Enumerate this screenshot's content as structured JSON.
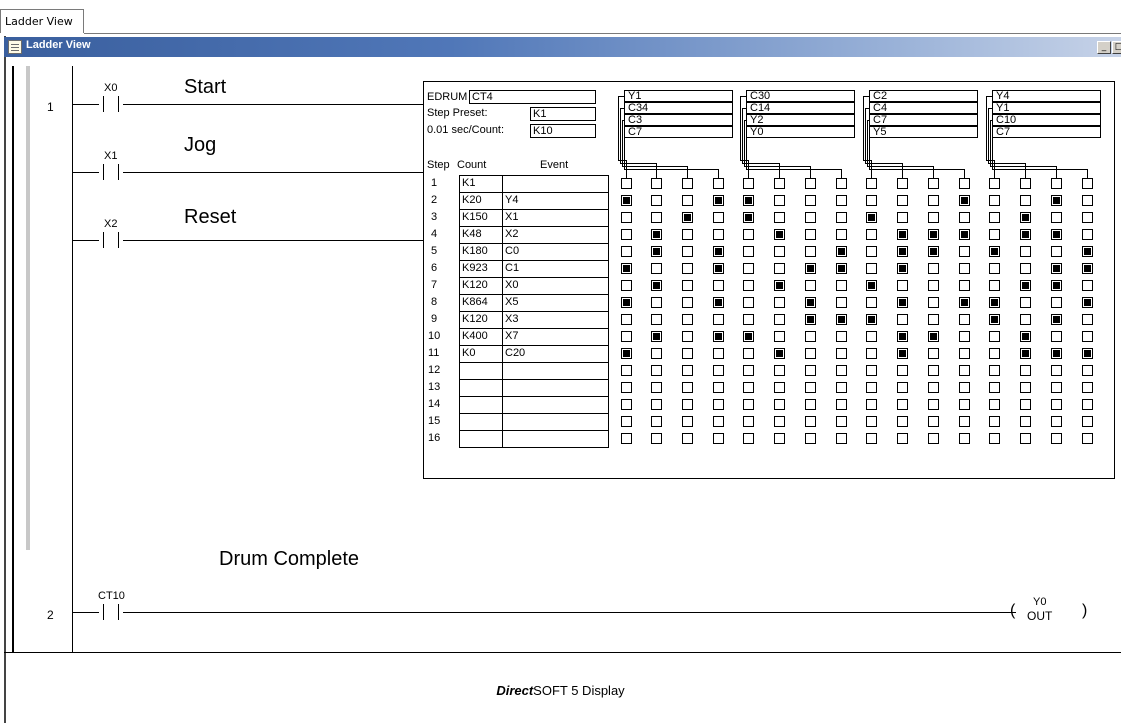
{
  "tab": {
    "label": "Ladder View"
  },
  "window": {
    "title": "Ladder View"
  },
  "rungs": [
    {
      "number": "1",
      "contacts": [
        {
          "address": "X0",
          "label": "Start"
        },
        {
          "address": "X1",
          "label": "Jog"
        },
        {
          "address": "X2",
          "label": "Reset"
        }
      ]
    },
    {
      "number": "2",
      "contact": {
        "address": "CT10",
        "label": "Drum Complete"
      },
      "coil": {
        "address": "Y0",
        "type": "OUT"
      }
    }
  ],
  "drum": {
    "instruction": "EDRUM",
    "counter": "CT4",
    "step_preset_label": "Step Preset:",
    "step_preset": "K1",
    "count_label": "0.01 sec/Count:",
    "count_value": "K10",
    "header_step": "Step",
    "header_count": "Count",
    "header_event": "Event",
    "output_groups": [
      [
        "Y1",
        "C34",
        "C3",
        "C7"
      ],
      [
        "C30",
        "C14",
        "Y2",
        "Y0"
      ],
      [
        "C2",
        "C4",
        "C7",
        "Y5"
      ],
      [
        "Y4",
        "Y1",
        "C10",
        "C7"
      ]
    ],
    "steps": [
      {
        "step": "1",
        "count": "K1",
        "event": "",
        "bits": "0000000000000000"
      },
      {
        "step": "2",
        "count": "K20",
        "event": "Y4",
        "bits": "1001100000010010"
      },
      {
        "step": "3",
        "count": "K150",
        "event": "X1",
        "bits": "0010100010000100"
      },
      {
        "step": "4",
        "count": "K48",
        "event": "X2",
        "bits": "0100010001110110"
      },
      {
        "step": "5",
        "count": "K180",
        "event": "C0",
        "bits": "0101000101101001"
      },
      {
        "step": "6",
        "count": "K923",
        "event": "C1",
        "bits": "1001001101000011"
      },
      {
        "step": "7",
        "count": "K120",
        "event": "X0",
        "bits": "0100010010000110"
      },
      {
        "step": "8",
        "count": "K864",
        "event": "X5",
        "bits": "1001001001011001"
      },
      {
        "step": "9",
        "count": "K120",
        "event": "X3",
        "bits": "0000001110001010"
      },
      {
        "step": "10",
        "count": "K400",
        "event": "X7",
        "bits": "0101100001100100"
      },
      {
        "step": "11",
        "count": "K0",
        "event": "C20",
        "bits": "1000010001000111"
      },
      {
        "step": "12",
        "count": "",
        "event": "",
        "bits": "0000000000000000"
      },
      {
        "step": "13",
        "count": "",
        "event": "",
        "bits": "0000000000000000"
      },
      {
        "step": "14",
        "count": "",
        "event": "",
        "bits": "0000000000000000"
      },
      {
        "step": "15",
        "count": "",
        "event": "",
        "bits": "0000000000000000"
      },
      {
        "step": "16",
        "count": "",
        "event": "",
        "bits": "0000000000000000"
      }
    ]
  },
  "caption": {
    "bold": "Direct",
    "rest": "SOFT 5 Display"
  }
}
